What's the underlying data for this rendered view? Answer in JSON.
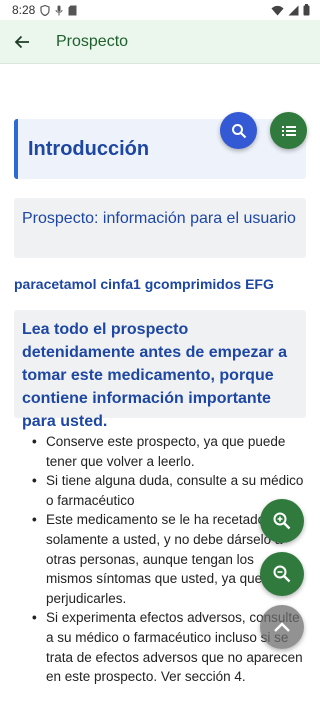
{
  "status_bar": {
    "time": "8:28"
  },
  "app_bar": {
    "title": "Prospecto"
  },
  "document": {
    "intro_heading": "Introducción",
    "section_heading": "Prospecto: información para el usuario",
    "drug_name": "paracetamol cinfa1 gcomprimidos EFG",
    "warning": "Lea todo el prospecto detenidamente antes de empezar a tomar este medicamento, porque contiene información importante para usted.",
    "bullets": [
      "Conserve este prospecto, ya que puede tener que volver a leerlo.",
      "Si tiene alguna duda, consulte a su médico o farmacéutico",
      "Este medicamento se le ha recetado solamente a usted, y no debe dárselo a otras personas, aunque tengan los mismos síntomas que usted, ya que puede perjudicarles.",
      "Si experimenta efectos adversos, consulte a su médico o farmacéutico incluso si se trata de efectos adversos que no aparecen en este prospecto. Ver sección 4."
    ]
  },
  "colors": {
    "app_bar_bg": "#ebf6ec",
    "title_green": "#1e5f2e",
    "heading_blue": "#1d47a3",
    "accent_blue": "#2d6ad6",
    "fab_green": "#2f7a3c",
    "fab_blue": "#3359d4"
  },
  "icons": {
    "back": "arrow-left-icon",
    "search": "search-icon",
    "toc": "list-icon",
    "zoom_in": "zoom-in-icon",
    "zoom_out": "zoom-out-icon",
    "scroll_top": "chevron-up-icon"
  }
}
